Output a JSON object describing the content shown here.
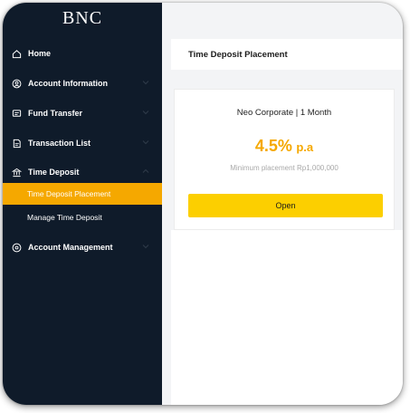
{
  "brand": {
    "logo_text": "BNC"
  },
  "sidebar": {
    "items": [
      {
        "label": "Home",
        "icon": "home-icon"
      },
      {
        "label": "Account Information",
        "icon": "account-icon"
      },
      {
        "label": "Fund Transfer",
        "icon": "transfer-icon"
      },
      {
        "label": "Transaction List",
        "icon": "list-icon"
      },
      {
        "label": "Time Deposit",
        "icon": "bank-icon"
      },
      {
        "label": "Account Management",
        "icon": "gear-icon"
      }
    ],
    "sub_items": [
      {
        "label": "Time Deposit Placement",
        "active": true
      },
      {
        "label": "Manage Time Deposit",
        "active": false
      }
    ]
  },
  "header": {
    "title": "Time Deposit Placement"
  },
  "card": {
    "product": "Neo Corporate | 1 Month",
    "rate": "4.5%",
    "rate_unit": "p.a",
    "minimum": "Minimum placement Rp1,000,000",
    "button_label": "Open"
  },
  "colors": {
    "sidebar_bg": "#0f1b2a",
    "accent_orange": "#f5a800",
    "button_yellow": "#fccf00"
  }
}
